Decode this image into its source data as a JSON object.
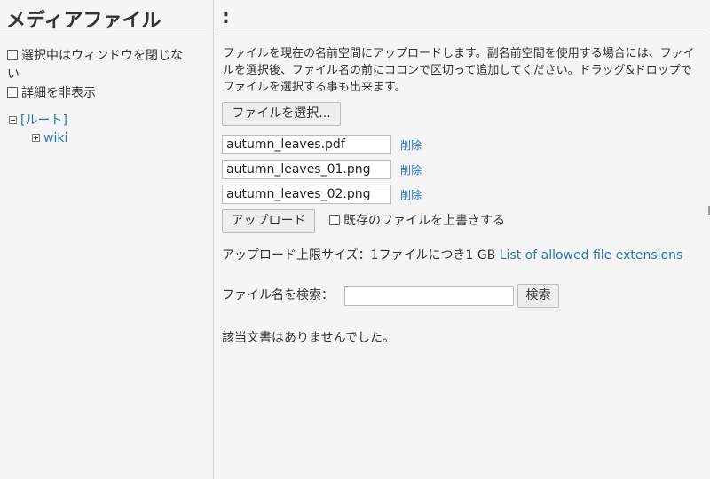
{
  "sidebar": {
    "title": "メディアファイル",
    "options": [
      {
        "label": "選択中はウィンドウを閉じな",
        "label_cont": "い"
      },
      {
        "label": "詳細を非表示"
      }
    ],
    "tree": {
      "root_label": "[ルート]",
      "children": [
        "wiki"
      ]
    }
  },
  "main": {
    "title": ":",
    "intro": "ファイルを現在の名前空間にアップロードします。副名前空間を使用する場合には、ファイルを選択後、ファイル名の前にコロンで区切って追加してください。ドラッグ&ドロップでファイルを選択する事も出来ます。",
    "choose_button": "ファイルを選択...",
    "files": [
      {
        "name": "autumn_leaves.pdf",
        "delete": "削除"
      },
      {
        "name": "autumn_leaves_01.png",
        "delete": "削除"
      },
      {
        "name": "autumn_leaves_02.png",
        "delete": "削除"
      }
    ],
    "upload_button": "アップロード",
    "overwrite_label": "既存のファイルを上書きする",
    "limit_text": "アップロード上限サイズ：1ファイルにつき1 GB",
    "allowed_link": "List of allowed file extensions",
    "search_label": "ファイル名を検索：",
    "search_value": "",
    "search_button": "検索",
    "no_results": "該当文書はありませんでした。"
  }
}
